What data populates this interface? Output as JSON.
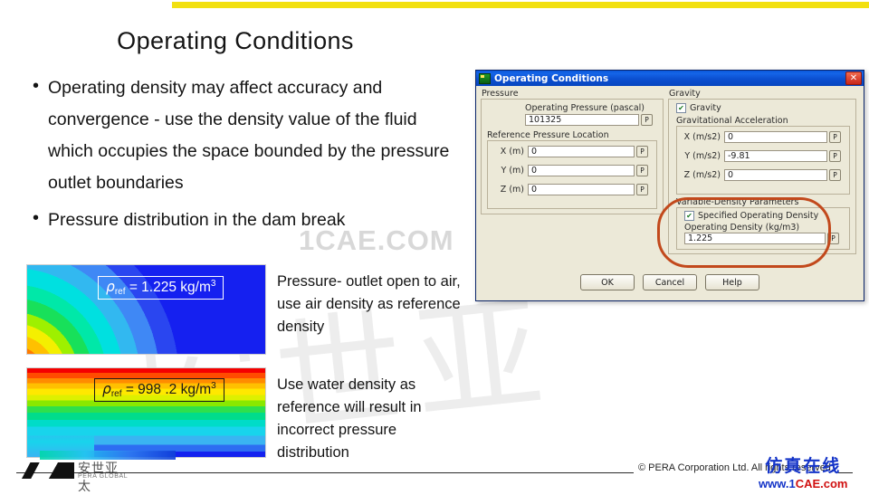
{
  "slide": {
    "title": "Operating Conditions",
    "bullet_marker": "•",
    "bullets": [
      "Operating density may affect accuracy and convergence - use the density value of the fluid which occupies the space bounded by the pressure outlet boundaries",
      "Pressure distribution in the dam break"
    ]
  },
  "figures": [
    {
      "name": "air-reference-density-contour",
      "tag_rho": "ρ",
      "tag_sub": "ref",
      "tag_eq": " = 1.225 kg/m",
      "tag_sup": "3",
      "caption": "Pressure- outlet open to air, use air density as reference  density"
    },
    {
      "name": "water-reference-density-contour",
      "tag_rho": "ρ",
      "tag_sub": "ref",
      "tag_eq": " = 998 .2 kg/m",
      "tag_sup": "3",
      "caption": "Use water density as reference will result in incorrect  pressure distribution"
    }
  ],
  "dialog": {
    "title": "Operating Conditions",
    "close_label": "✕",
    "pressure": {
      "group_label": "Pressure",
      "operating_pressure_label": "Operating Pressure (pascal)",
      "operating_pressure_value": "101325",
      "reference_location_label": "Reference Pressure Location",
      "fields": [
        {
          "label": "X (m)",
          "value": "0"
        },
        {
          "label": "Y (m)",
          "value": "0"
        },
        {
          "label": "Z (m)",
          "value": "0"
        }
      ]
    },
    "gravity": {
      "group_label": "Gravity",
      "checkbox_label": "Gravity",
      "checkbox_checked": "✔",
      "acceleration_label": "Gravitational Acceleration",
      "fields": [
        {
          "label": "X (m/s2)",
          "value": "0"
        },
        {
          "label": "Y (m/s2)",
          "value": "-9.81"
        },
        {
          "label": "Z (m/s2)",
          "value": "0"
        }
      ]
    },
    "variable_density": {
      "group_label": "Variable-Density Parameters",
      "checkbox_label": "Specified Operating Density",
      "checkbox_checked": "✔",
      "density_label": "Operating Density (kg/m3)",
      "density_value": "1.225"
    },
    "param_button_label": "P",
    "buttons": [
      {
        "label": "OK"
      },
      {
        "label": "Cancel"
      },
      {
        "label": "Help"
      }
    ]
  },
  "footer": {
    "copyright": "©  PERA Corporation Ltd. All rights reserved.",
    "logo_cn": "安世亚太",
    "logo_en": "PERA GLOBAL"
  },
  "watermarks": {
    "faint_site": "1CAE.COM",
    "faint_cn": "安世亚",
    "brand_cn": "仿真在线",
    "brand_url_www": "www.1",
    "brand_url_cae": "CAE.com"
  },
  "colors": {
    "accent_yellow": "#f2e010",
    "title_bar_blue": "#0b4fd0",
    "highlight_ring": "#c2491c",
    "dialog_face": "#ece9d8"
  }
}
